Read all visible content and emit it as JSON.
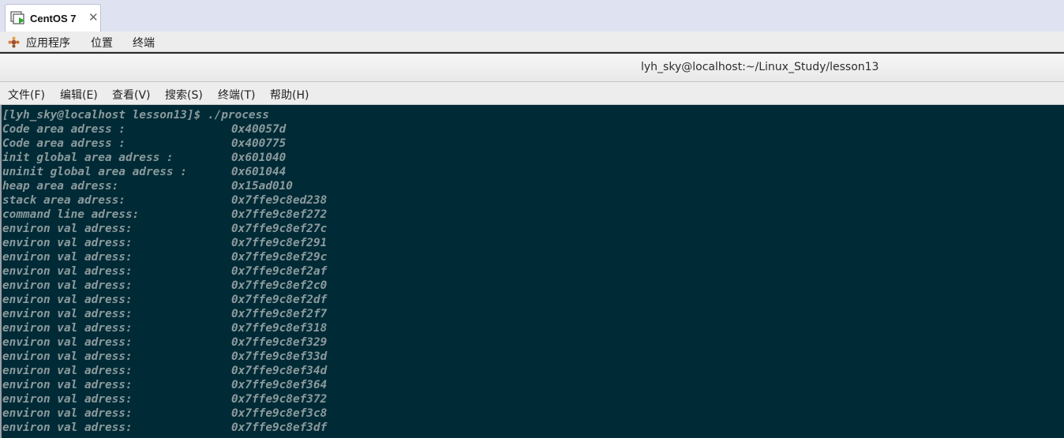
{
  "vm_tab": {
    "label": "CentOS 7",
    "close_glyph": "✕"
  },
  "panel": {
    "apps": "应用程序",
    "places": "位置",
    "terminal": "终端"
  },
  "window": {
    "title": "lyh_sky@localhost:~/Linux_Study/lesson13"
  },
  "menubar": {
    "file": "文件(F)",
    "edit": "编辑(E)",
    "view": "查看(V)",
    "search": "搜索(S)",
    "terminal": "终端(T)",
    "help": "帮助(H)"
  },
  "terminal": {
    "prompt": "[lyh_sky@localhost lesson13]$ ./process",
    "lines": [
      {
        "label": "Code area adress :",
        "value": "0x40057d"
      },
      {
        "label": "Code area adress :",
        "value": "0x400775"
      },
      {
        "label": "init global area adress :",
        "value": "0x601040"
      },
      {
        "label": "uninit global area adress :",
        "value": "0x601044"
      },
      {
        "label": "heap area adress:",
        "value": "0x15ad010"
      },
      {
        "label": "stack area adress:",
        "value": "0x7ffe9c8ed238"
      },
      {
        "label": "command line adress:",
        "value": "0x7ffe9c8ef272"
      },
      {
        "label": "environ val adress:",
        "value": "0x7ffe9c8ef27c"
      },
      {
        "label": "environ val adress:",
        "value": "0x7ffe9c8ef291"
      },
      {
        "label": "environ val adress:",
        "value": "0x7ffe9c8ef29c"
      },
      {
        "label": "environ val adress:",
        "value": "0x7ffe9c8ef2af"
      },
      {
        "label": "environ val adress:",
        "value": "0x7ffe9c8ef2c0"
      },
      {
        "label": "environ val adress:",
        "value": "0x7ffe9c8ef2df"
      },
      {
        "label": "environ val adress:",
        "value": "0x7ffe9c8ef2f7"
      },
      {
        "label": "environ val adress:",
        "value": "0x7ffe9c8ef318"
      },
      {
        "label": "environ val adress:",
        "value": "0x7ffe9c8ef329"
      },
      {
        "label": "environ val adress:",
        "value": "0x7ffe9c8ef33d"
      },
      {
        "label": "environ val adress:",
        "value": "0x7ffe9c8ef34d"
      },
      {
        "label": "environ val adress:",
        "value": "0x7ffe9c8ef364"
      },
      {
        "label": "environ val adress:",
        "value": "0x7ffe9c8ef372"
      },
      {
        "label": "environ val adress:",
        "value": "0x7ffe9c8ef3c8"
      },
      {
        "label": "environ val adress:",
        "value": "0x7ffe9c8ef3df"
      }
    ]
  },
  "colors": {
    "terminal_bg": "#002b36",
    "terminal_fg": "#8c9a9d",
    "panel_bg": "#ededed",
    "tabstrip_bg": "#dfe3f1"
  }
}
